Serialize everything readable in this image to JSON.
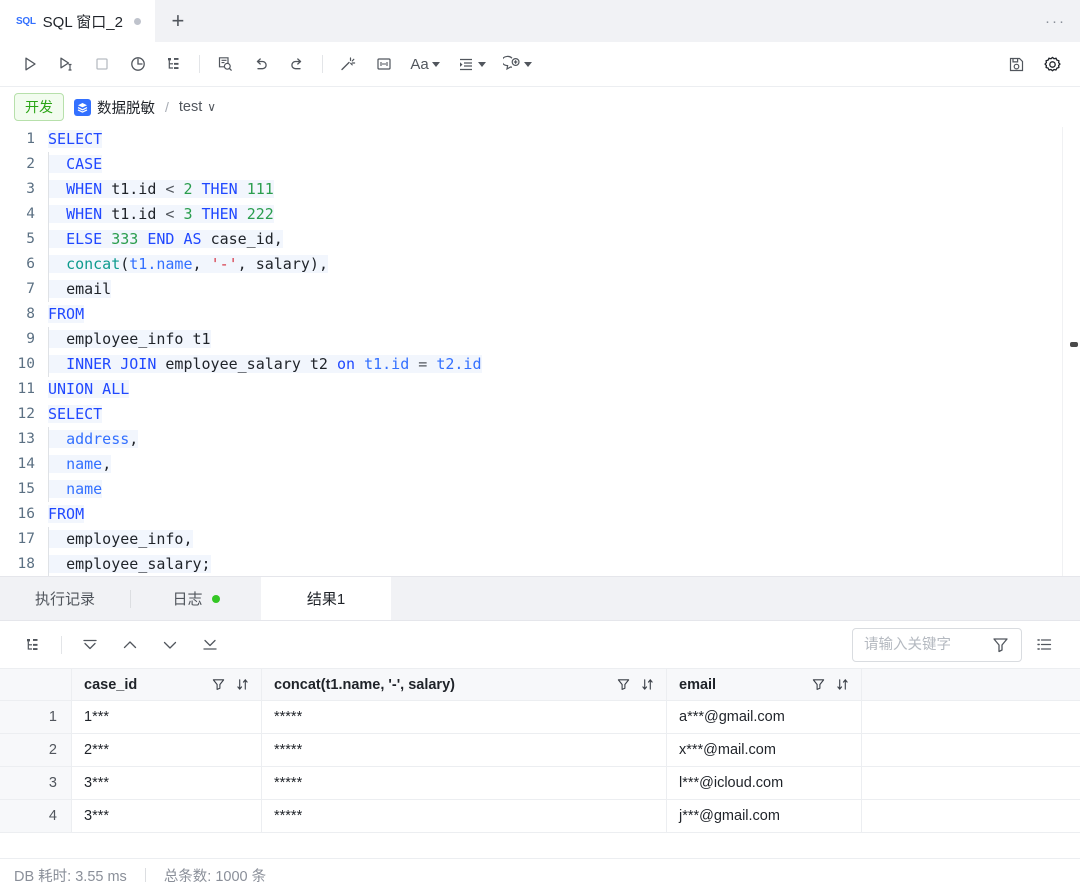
{
  "tabbar": {
    "sql_badge": "SQL",
    "title": "SQL 窗口_2",
    "new_tab": "+",
    "more": "···"
  },
  "toolbar": {
    "run": "run-icon",
    "run_step": "run-to-cursor-icon",
    "stop": "stop-icon",
    "history": "timer-icon",
    "format": "structure-icon",
    "explain": "explain-plan-icon",
    "undo": "undo-icon",
    "redo": "redo-icon",
    "beautify": "magic-wand-icon",
    "split": "split-view-icon",
    "font": "Aa",
    "indent": "indent-icon",
    "comment": "add-comment-icon",
    "save": "save-icon",
    "settings": "gear-icon"
  },
  "breadcrumb": {
    "env": "开发",
    "datasource": "数据脱敏",
    "separator": "/",
    "database": "test",
    "chevron": "∨"
  },
  "editor": {
    "lines": [
      {
        "no": "1",
        "tokens": [
          {
            "t": "SELECT",
            "c": "k"
          }
        ]
      },
      {
        "no": "2",
        "tokens": [
          {
            "t": "  ",
            "c": "p"
          },
          {
            "t": "CASE",
            "c": "k"
          }
        ]
      },
      {
        "no": "3",
        "tokens": [
          {
            "t": "  ",
            "c": "p"
          },
          {
            "t": "WHEN",
            "c": "k"
          },
          {
            "t": " ",
            "c": "p"
          },
          {
            "t": "t1.id",
            "c": "p"
          },
          {
            "t": " ",
            "c": "p"
          },
          {
            "t": "<",
            "c": "op"
          },
          {
            "t": " ",
            "c": "p"
          },
          {
            "t": "2",
            "c": "n"
          },
          {
            "t": " ",
            "c": "p"
          },
          {
            "t": "THEN",
            "c": "k"
          },
          {
            "t": " ",
            "c": "p"
          },
          {
            "t": "111",
            "c": "n"
          }
        ]
      },
      {
        "no": "4",
        "tokens": [
          {
            "t": "  ",
            "c": "p"
          },
          {
            "t": "WHEN",
            "c": "k"
          },
          {
            "t": " ",
            "c": "p"
          },
          {
            "t": "t1.id",
            "c": "p"
          },
          {
            "t": " ",
            "c": "p"
          },
          {
            "t": "<",
            "c": "op"
          },
          {
            "t": " ",
            "c": "p"
          },
          {
            "t": "3",
            "c": "n"
          },
          {
            "t": " ",
            "c": "p"
          },
          {
            "t": "THEN",
            "c": "k"
          },
          {
            "t": " ",
            "c": "p"
          },
          {
            "t": "222",
            "c": "n"
          }
        ]
      },
      {
        "no": "5",
        "tokens": [
          {
            "t": "  ",
            "c": "p"
          },
          {
            "t": "ELSE",
            "c": "k"
          },
          {
            "t": " ",
            "c": "p"
          },
          {
            "t": "333",
            "c": "n"
          },
          {
            "t": " ",
            "c": "p"
          },
          {
            "t": "END",
            "c": "k"
          },
          {
            "t": " ",
            "c": "p"
          },
          {
            "t": "AS",
            "c": "k"
          },
          {
            "t": " ",
            "c": "p"
          },
          {
            "t": "case_id,",
            "c": "p"
          }
        ]
      },
      {
        "no": "6",
        "tokens": [
          {
            "t": "  ",
            "c": "p"
          },
          {
            "t": "concat",
            "c": "f"
          },
          {
            "t": "(",
            "c": "p"
          },
          {
            "t": "t1.name",
            "c": "id"
          },
          {
            "t": ", ",
            "c": "p"
          },
          {
            "t": "'-'",
            "c": "s"
          },
          {
            "t": ", salary)",
            "c": "p"
          },
          {
            "t": ",",
            "c": "p"
          }
        ]
      },
      {
        "no": "7",
        "tokens": [
          {
            "t": "  ",
            "c": "p"
          },
          {
            "t": "email",
            "c": "p"
          }
        ]
      },
      {
        "no": "8",
        "tokens": [
          {
            "t": "FROM",
            "c": "k"
          }
        ]
      },
      {
        "no": "9",
        "tokens": [
          {
            "t": "  ",
            "c": "p"
          },
          {
            "t": "employee_info t1",
            "c": "p"
          }
        ]
      },
      {
        "no": "10",
        "tokens": [
          {
            "t": "  ",
            "c": "p"
          },
          {
            "t": "INNER JOIN",
            "c": "k"
          },
          {
            "t": " employee_salary t2 ",
            "c": "p"
          },
          {
            "t": "on",
            "c": "k"
          },
          {
            "t": " ",
            "c": "p"
          },
          {
            "t": "t1.id",
            "c": "id"
          },
          {
            "t": " ",
            "c": "p"
          },
          {
            "t": "=",
            "c": "op"
          },
          {
            "t": " ",
            "c": "p"
          },
          {
            "t": "t2.id",
            "c": "id"
          }
        ]
      },
      {
        "no": "11",
        "tokens": [
          {
            "t": "UNION ALL",
            "c": "k"
          }
        ]
      },
      {
        "no": "12",
        "tokens": [
          {
            "t": "SELECT",
            "c": "k"
          }
        ]
      },
      {
        "no": "13",
        "tokens": [
          {
            "t": "  ",
            "c": "p"
          },
          {
            "t": "address",
            "c": "id"
          },
          {
            "t": ",",
            "c": "p"
          }
        ]
      },
      {
        "no": "14",
        "tokens": [
          {
            "t": "  ",
            "c": "p"
          },
          {
            "t": "name",
            "c": "id"
          },
          {
            "t": ",",
            "c": "p"
          }
        ]
      },
      {
        "no": "15",
        "tokens": [
          {
            "t": "  ",
            "c": "p"
          },
          {
            "t": "name",
            "c": "id"
          }
        ]
      },
      {
        "no": "16",
        "tokens": [
          {
            "t": "FROM",
            "c": "k"
          }
        ]
      },
      {
        "no": "17",
        "tokens": [
          {
            "t": "  ",
            "c": "p"
          },
          {
            "t": "employee_info,",
            "c": "p"
          }
        ]
      },
      {
        "no": "18",
        "tokens": [
          {
            "t": "  ",
            "c": "p"
          },
          {
            "t": "employee_salary;",
            "c": "p"
          }
        ]
      }
    ]
  },
  "result_tabs": [
    {
      "label": "执行记录",
      "active": false,
      "dot": false
    },
    {
      "label": "日志",
      "active": false,
      "dot": true
    },
    {
      "label": "结果1",
      "active": true,
      "dot": false
    }
  ],
  "result_toolbar": {
    "structure": "structure-icon",
    "first": "first-page-icon",
    "prev": "prev-page-icon",
    "next": "next-page-icon",
    "last": "last-page-icon",
    "search_placeholder": "请输入关键字",
    "search_value": "",
    "search_icon": "search-icon",
    "filter_icon": "filter-icon",
    "columns_icon": "list-icon"
  },
  "grid": {
    "columns": [
      "case_id",
      "concat(t1.name, '-', salary)",
      "email"
    ],
    "rows": [
      {
        "no": "1",
        "case_id": "1***",
        "concat": "*****",
        "email": "a***@gmail.com"
      },
      {
        "no": "2",
        "case_id": "2***",
        "concat": "*****",
        "email": "x***@mail.com"
      },
      {
        "no": "3",
        "case_id": "3***",
        "concat": "*****",
        "email": "l***@icloud.com"
      },
      {
        "no": "4",
        "case_id": "3***",
        "concat": "*****",
        "email": "j***@gmail.com"
      }
    ]
  },
  "statusbar": {
    "duration": "DB 耗时: 3.55 ms",
    "total": "总条数: 1000 条"
  },
  "colors": {
    "accent": "#3370ff",
    "env_green": "#2aa515",
    "status_green": "#34c724",
    "keyword": "#2048ff",
    "number": "#2a9d4e",
    "function": "#0f9b8e",
    "string": "#d73a49"
  }
}
